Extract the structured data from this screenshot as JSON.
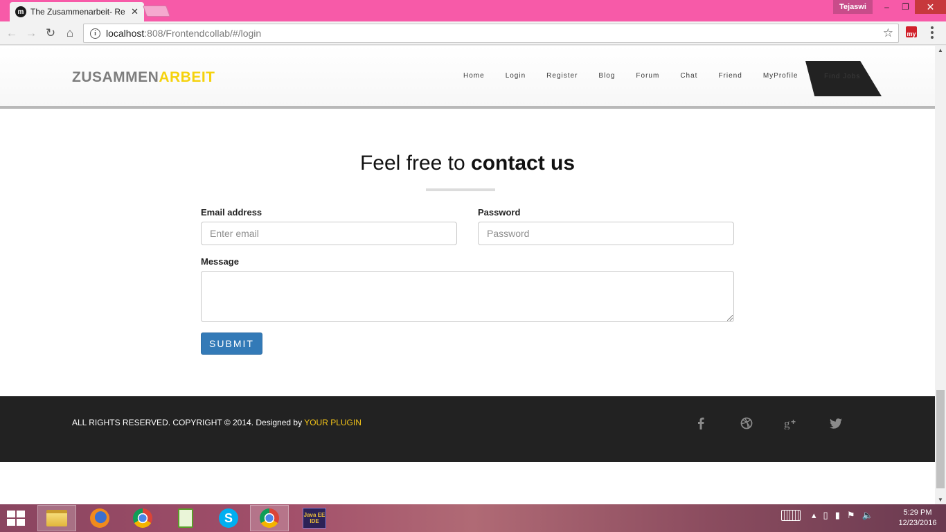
{
  "browser": {
    "tab_title": "The Zusammenarbeit- Re",
    "tab_close": "✕",
    "profile_name": "Tejaswi",
    "url_host": "localhost",
    "url_rest": ":808/Frontendcollab/#/login",
    "ext_label": "my"
  },
  "site": {
    "brand_part1": "ZUSAMMEN",
    "brand_part2": "ARBEIT",
    "nav": [
      {
        "label": "Home"
      },
      {
        "label": "Login"
      },
      {
        "label": "Register"
      },
      {
        "label": "Blog"
      },
      {
        "label": "Forum"
      },
      {
        "label": "Chat"
      },
      {
        "label": "Friend"
      },
      {
        "label": "MyProfile"
      }
    ],
    "find_jobs": "Find Jobs"
  },
  "contact": {
    "title_light": "Feel free to ",
    "title_bold": "contact us",
    "email_label": "Email address",
    "email_placeholder": "Enter email",
    "password_label": "Password",
    "password_placeholder": "Password",
    "message_label": "Message",
    "submit": "SUBMIT"
  },
  "footer": {
    "copyright": "ALL RIGHTS RESERVED. COPYRIGHT © 2014. Designed by ",
    "designer": "YOUR PLUGIN",
    "social": [
      "facebook-icon",
      "dribbble-icon",
      "google-plus-icon",
      "twitter-icon"
    ]
  },
  "taskbar": {
    "apps": [
      "file-explorer-icon",
      "firefox-icon",
      "chrome-icon",
      "notepad-plus-icon",
      "skype-icon",
      "chrome-icon",
      "java-ee-ide-icon"
    ],
    "java_label": "Java EE IDE",
    "time": "5:29 PM",
    "date": "12/23/2016"
  },
  "colors": {
    "tabstrip": "#f75aa8",
    "brand_accent": "#f5d20c",
    "submit": "#337ab7",
    "footer": "#222222",
    "footer_link": "#f5c518"
  }
}
